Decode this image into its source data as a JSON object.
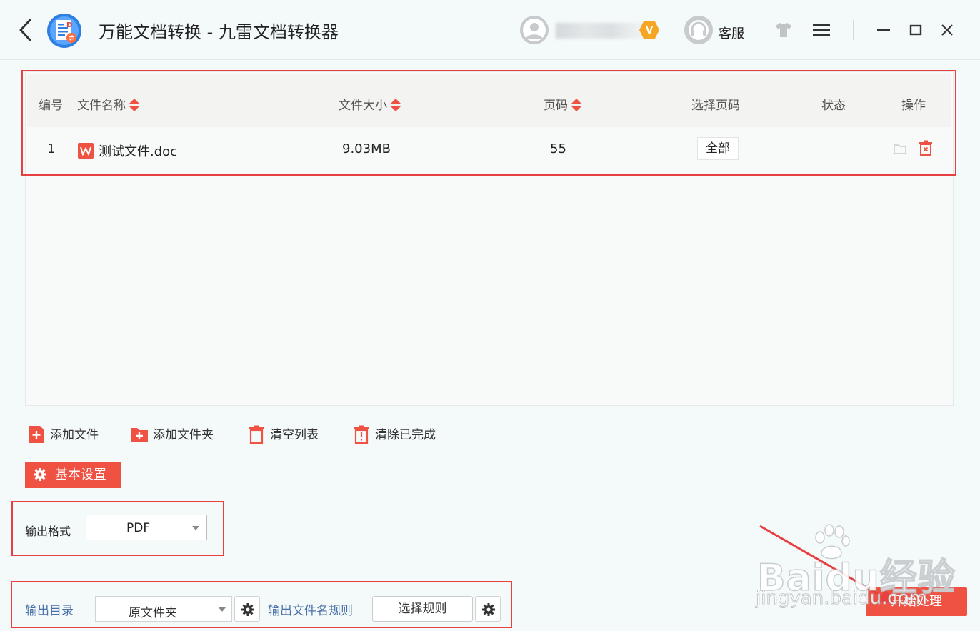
{
  "app": {
    "title": "万能文档转换 - 九雷文档转换器",
    "user_name": "",
    "customer_service": "客服"
  },
  "table": {
    "headers": {
      "index": "编号",
      "name": "文件名称",
      "size": "文件大小",
      "pages": "页码",
      "select_pages": "选择页码",
      "status": "状态",
      "operation": "操作"
    },
    "rows": [
      {
        "index": "1",
        "name": "测试文件.doc",
        "size": "9.03MB",
        "pages": "55",
        "select_pages": "全部",
        "status": ""
      }
    ]
  },
  "actions": {
    "add_file": "添加文件",
    "add_folder": "添加文件夹",
    "clear_list": "清空列表",
    "clear_done": "清除已完成"
  },
  "settings": {
    "basic_settings": "基本设置",
    "output_format_label": "输出格式",
    "output_format_value": "PDF",
    "output_dir_label": "输出目录",
    "output_dir_value": "原文件夹",
    "filename_rule_label": "输出文件名规则",
    "filename_rule_button": "选择规则"
  },
  "start_button": "开始处理",
  "watermark": {
    "logo": "Baidu经验",
    "url": "jingyan.baidu.com"
  },
  "colors": {
    "accent": "#ef5242",
    "highlight": "#e84040",
    "link_blue": "#4b72a8"
  }
}
